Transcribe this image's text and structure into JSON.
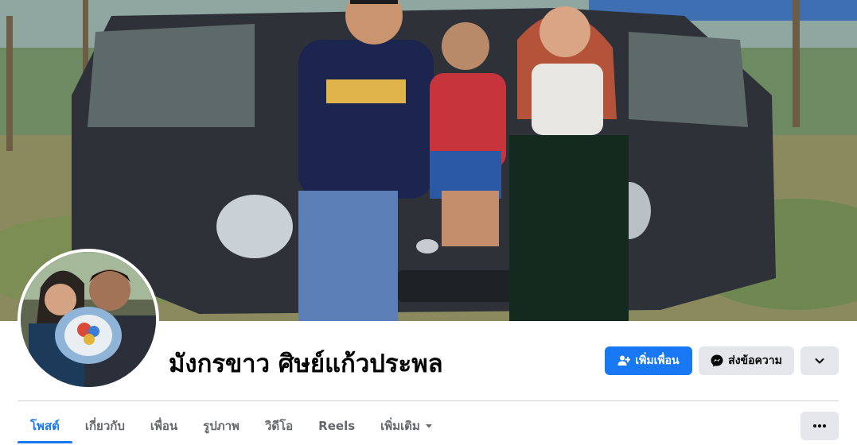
{
  "profile": {
    "name": "มังกรขาว ศิษย์แก้วประพล"
  },
  "actions": {
    "add_friend_label": "เพิ่มเพื่อน",
    "add_friend_icon": "person-plus-icon",
    "message_label": "ส่งข้อความ",
    "message_icon": "messenger-icon",
    "more_icon": "chevron-down-icon"
  },
  "tabs": [
    {
      "label": "โพสต์",
      "active": true
    },
    {
      "label": "เกี่ยวกับ",
      "active": false
    },
    {
      "label": "เพื่อน",
      "active": false
    },
    {
      "label": "รูปภาพ",
      "active": false
    },
    {
      "label": "วิดีโอ",
      "active": false
    },
    {
      "label": "Reels",
      "active": false
    },
    {
      "label": "เพิ่มเติม",
      "active": false,
      "icon": "caret-down-icon"
    }
  ],
  "tab_overflow_icon": "ellipsis-icon",
  "colors": {
    "accent": "#1877f2",
    "button_secondary": "#e4e6eb",
    "text_primary": "#050505",
    "text_secondary": "#65676b",
    "divider": "#ced0d4"
  }
}
